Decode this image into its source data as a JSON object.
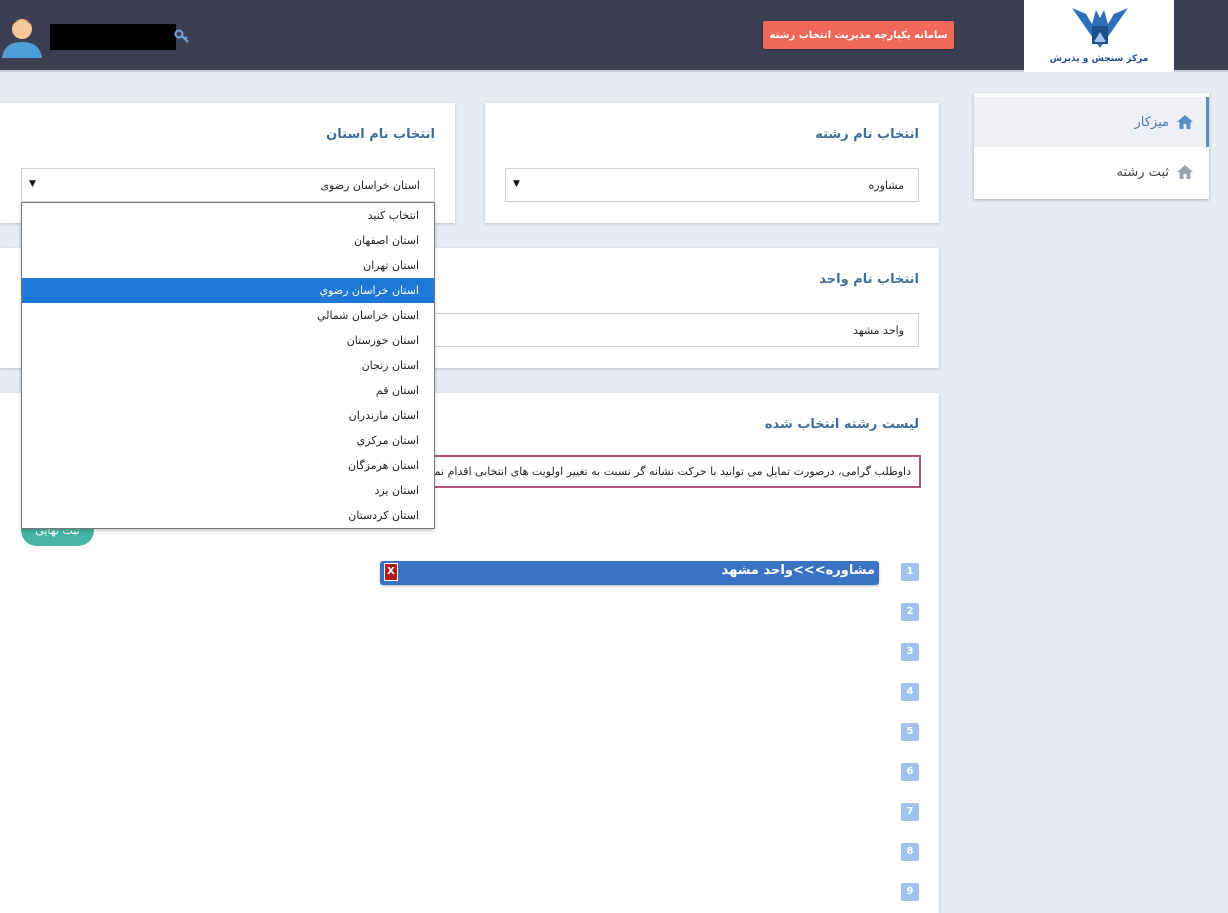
{
  "header": {
    "logo_text": "مرکز سنجش و پذیرش",
    "title_button": "سامانه یکپارچه مدیریت انتخاب رشته"
  },
  "sidebar": {
    "items": [
      {
        "label": "میزکار",
        "icon": "home-icon",
        "active": true
      },
      {
        "label": "ثبت رشته",
        "icon": "home-icon",
        "active": false
      }
    ]
  },
  "field_panel": {
    "title": "انتخاب نام رشته",
    "selected": "مشاوره"
  },
  "province_panel": {
    "title": "انتخاب نام استان",
    "selected": "استان خراسان رضوی",
    "options": [
      "انتخاب کنید",
      "استان اصفهان",
      "استان تهران",
      "استان خراسان رضوي",
      "استان خراسان شمالي",
      "استان خوزستان",
      "استان زنجان",
      "استان قم",
      "استان مازندران",
      "استان مرکزي",
      "استان هرمزگان",
      "استان يزد",
      "استان کردستان"
    ],
    "highlighted_index": 3
  },
  "unit_panel": {
    "title": "انتخاب نام واحد",
    "selected": "واحد مشهد"
  },
  "list_panel": {
    "title": "لیست رشته انتخاب شده",
    "notice": "داوطلب گرامی، درصورت تمایل می توانید با حرکت نشانه گر نسبت به تغییر اولویت های انتخابی اقدام نمایید",
    "final_button": "ثبت نهایی",
    "delete_label": "X",
    "priorities": [
      {
        "number": "1",
        "text": "مشاوره>>>واحد مشهد"
      },
      {
        "number": "2",
        "text": ""
      },
      {
        "number": "3",
        "text": ""
      },
      {
        "number": "4",
        "text": ""
      },
      {
        "number": "5",
        "text": ""
      },
      {
        "number": "6",
        "text": ""
      },
      {
        "number": "7",
        "text": ""
      },
      {
        "number": "8",
        "text": ""
      },
      {
        "number": "9",
        "text": ""
      }
    ]
  }
}
